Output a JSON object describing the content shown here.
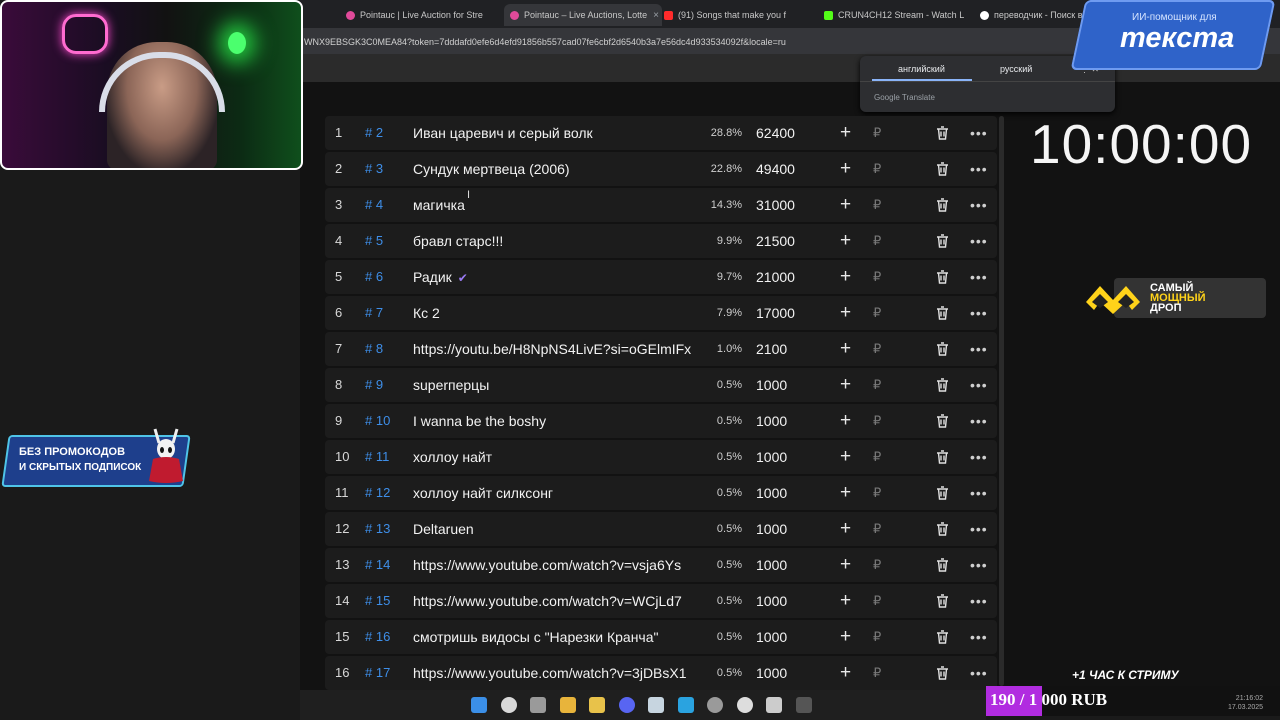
{
  "browser": {
    "tabs": [
      {
        "label": "Pointauc | Live Auction for Stre",
        "active": false
      },
      {
        "label": "Pointauc – Live Auctions, Lotte",
        "active": true
      },
      {
        "label": "(91) Songs that make you f",
        "active": false
      },
      {
        "label": "CRUN4CH12 Stream - Watch L",
        "active": false
      },
      {
        "label": "переводчик - Поиск в Go",
        "active": false
      }
    ],
    "url": "WNX9EBSGK3C0MEA84?token=7dddafd0efe6d4efd91856b557cad07fe6cbf2d6540b3a7e56dc4d933534092f&locale=ru"
  },
  "translate_popup": {
    "source_lang": "английский",
    "target_lang": "русский",
    "footer": "Google Translate"
  },
  "overlay": {
    "ai_badge_small": "ИИ-помощник для",
    "ai_badge_big": "текста",
    "drop_line1": "САМЫЙ",
    "drop_line2": "МОЩНЫЙ",
    "drop_line3": "ДРОП",
    "promo_line1": "БЕЗ ПРОМОКОДОВ",
    "promo_line2": "И СКРЫТЫХ ПОДПИСОК",
    "stream_hour": "+1 ЧАС К СТРИМУ",
    "goal_text": "190 / 1 000 RUB",
    "goal_progress": 0.19,
    "clock_time": "21:16:02",
    "clock_date": "17.03.2025"
  },
  "timer": "10:00:00",
  "lots": [
    {
      "idx": "1",
      "fast": "# 2",
      "name": "Иван царевич и серый волк",
      "pct": "28.8%",
      "amount": "62400"
    },
    {
      "idx": "2",
      "fast": "# 3",
      "name": "Сундук мертвеца (2006)",
      "pct": "22.8%",
      "amount": "49400"
    },
    {
      "idx": "3",
      "fast": "# 4",
      "name": "магичка",
      "pct": "14.3%",
      "amount": "31000"
    },
    {
      "idx": "4",
      "fast": "# 5",
      "name": "бравл старс!!!",
      "pct": "9.9%",
      "amount": "21500"
    },
    {
      "idx": "5",
      "fast": "# 6",
      "name": "Радик",
      "pct": "9.7%",
      "amount": "21000",
      "check": true
    },
    {
      "idx": "6",
      "fast": "# 7",
      "name": "Кс 2",
      "pct": "7.9%",
      "amount": "17000"
    },
    {
      "idx": "7",
      "fast": "# 8",
      "name": "https://youtu.be/H8NpNS4LivE?si=oGElmIFx",
      "pct": "1.0%",
      "amount": "2100"
    },
    {
      "idx": "8",
      "fast": "# 9",
      "name": "superперцы",
      "pct": "0.5%",
      "amount": "1000"
    },
    {
      "idx": "9",
      "fast": "# 10",
      "name": "I wanna be the boshy",
      "pct": "0.5%",
      "amount": "1000"
    },
    {
      "idx": "10",
      "fast": "# 11",
      "name": "холлоу найт",
      "pct": "0.5%",
      "amount": "1000"
    },
    {
      "idx": "11",
      "fast": "# 12",
      "name": "холлоу найт силксонг",
      "pct": "0.5%",
      "amount": "1000"
    },
    {
      "idx": "12",
      "fast": "# 13",
      "name": "Deltaruen",
      "pct": "0.5%",
      "amount": "1000"
    },
    {
      "idx": "13",
      "fast": "# 14",
      "name": "https://www.youtube.com/watch?v=vsja6Ys",
      "pct": "0.5%",
      "amount": "1000"
    },
    {
      "idx": "14",
      "fast": "# 15",
      "name": "https://www.youtube.com/watch?v=WCjLd7",
      "pct": "0.5%",
      "amount": "1000"
    },
    {
      "idx": "15",
      "fast": "# 16",
      "name": "смотришь видосы с \"Нарезки Кранча\"",
      "pct": "0.5%",
      "amount": "1000"
    },
    {
      "idx": "16",
      "fast": "# 17",
      "name": "https://www.youtube.com/watch?v=3jDBsX1",
      "pct": "0.5%",
      "amount": "1000"
    }
  ],
  "row_icons": {
    "add": "plus-icon",
    "currency": "ruble-icon",
    "delete": "trash-icon",
    "more": "more-icon"
  },
  "taskbar_icons": [
    "windows-start-icon",
    "search-icon",
    "task-view-icon",
    "chrome-icon",
    "folder-icon",
    "discord-icon",
    "steam-icon",
    "telegram-icon",
    "settings-icon",
    "obs-icon",
    "notepad-icon",
    "terminal-icon"
  ],
  "colors": {
    "fast_id": "#3e8ee8",
    "goal_fill": "#b12ce0",
    "row_bg": "#1c1c1c"
  }
}
